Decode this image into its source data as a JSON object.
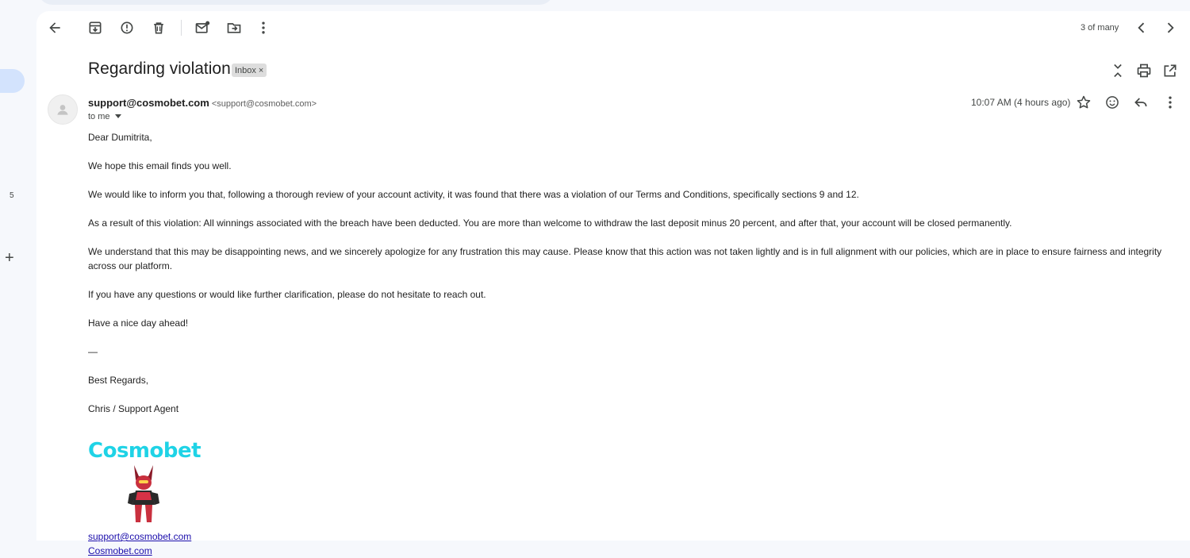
{
  "toolbar": {
    "back": "arrow-back-icon",
    "archive": "archive-icon",
    "report_spam": "report-spam-icon",
    "delete": "delete-icon",
    "mark_unread": "mark-unread-icon",
    "move_to": "move-to-icon",
    "more": "more-vert-icon",
    "pager_text": "3 of many",
    "newer": "chevron-left-icon",
    "older": "chevron-right-icon"
  },
  "sidebar": {
    "count": "5"
  },
  "thread": {
    "subject": "Regarding violation",
    "label": "Inbox",
    "label_remove": "×"
  },
  "message": {
    "sender_name": "support@cosmobet.com",
    "sender_address": "<support@cosmobet.com>",
    "to": "to me",
    "timestamp": "10:07 AM (4 hours ago)",
    "greeting": "Dear Dumitrita,",
    "paragraphs": [
      "We hope this email finds you well.",
      "We would like to inform you that, following a thorough review of your account activity, it was found that there was a violation of our Terms and Conditions, specifically sections 9 and 12.",
      "As a result of this violation: All winnings associated with the breach have been deducted. You are more than welcome to withdraw the last deposit minus 20 percent, and after that, your account will be closed permanently.",
      "We understand that this may be disappointing news, and we sincerely apologize for any frustration this may cause. Please know that this action was not taken lightly and is in full alignment with our policies, which are in place to ensure fairness and integrity across our platform.",
      "If you have any questions or would like further clarification, please do not hesitate to reach out.",
      "Have a nice day ahead!"
    ],
    "signature": {
      "dash": "—",
      "regards": "Best Regards,",
      "agent": "Chris / Support Agent",
      "logo_text": "Cosmobet",
      "email_link": "support@cosmobet.com",
      "site_link": "Cosmobet.com"
    }
  },
  "colors": {
    "link": "#1a0dab",
    "logo": "#1fd3e6",
    "selected": "#d3e3fd"
  }
}
